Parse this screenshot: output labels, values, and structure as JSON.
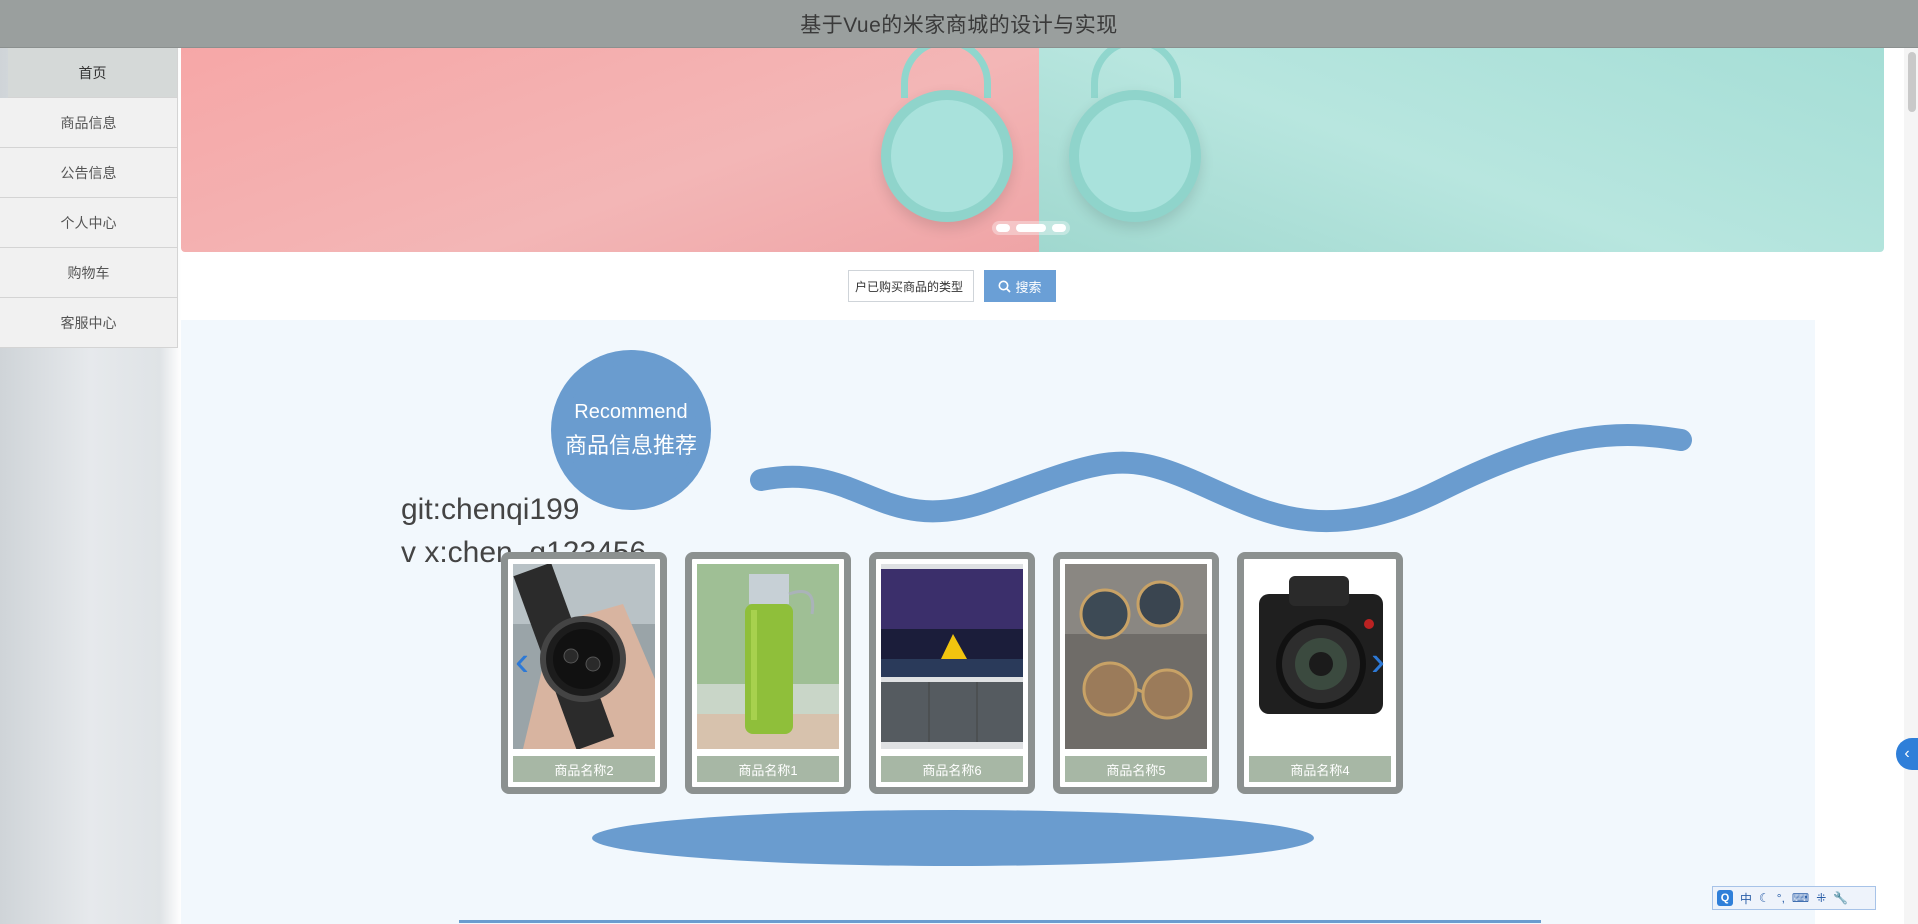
{
  "header": {
    "title": "基于Vue的米家商城的设计与实现"
  },
  "sidebar": {
    "items": [
      {
        "label": "首页",
        "active": true
      },
      {
        "label": "商品信息"
      },
      {
        "label": "公告信息"
      },
      {
        "label": "个人中心"
      },
      {
        "label": "购物车"
      },
      {
        "label": "客服中心"
      }
    ]
  },
  "search": {
    "value": "户已购买商品的类型",
    "button_label": "搜索"
  },
  "recommend": {
    "badge_en": "Recommend",
    "badge_cn": "商品信息推荐",
    "git_line": "git:chenqi199",
    "vx_line": "v x:chen_q123456",
    "products": [
      {
        "name": "商品名称2",
        "image": "watch"
      },
      {
        "name": "商品名称1",
        "image": "bottle"
      },
      {
        "name": "商品名称6",
        "image": "tv"
      },
      {
        "name": "商品名称5",
        "image": "sunglasses"
      },
      {
        "name": "商品名称4",
        "image": "camera"
      }
    ],
    "prev_icon": "‹",
    "next_icon": "›"
  },
  "ime": {
    "q": "Q",
    "mode": "中"
  },
  "colors": {
    "accent": "#6a9ccf",
    "header": "#9a9f9e"
  }
}
